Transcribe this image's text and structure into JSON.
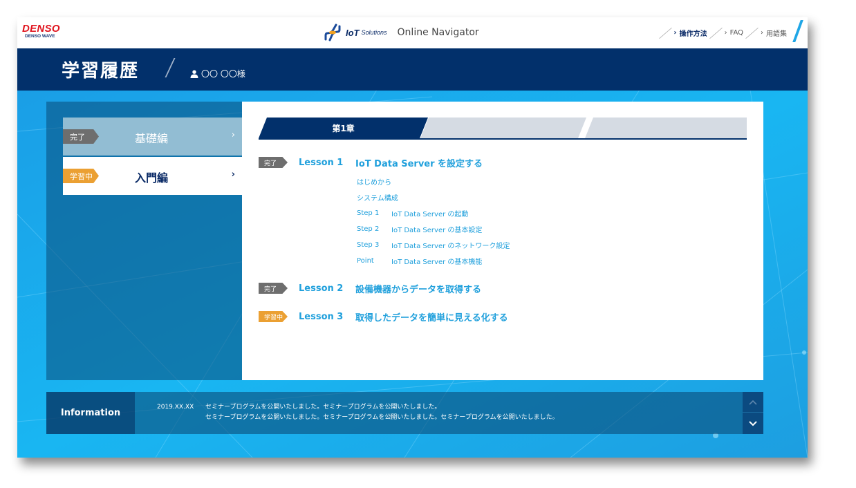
{
  "brand": {
    "name": "DENSO",
    "sub": "DENSO WAVE"
  },
  "header": {
    "product_main": "IoT",
    "product_sub": "Solutions",
    "app_name": "Online Navigator",
    "nav": [
      {
        "label": "操作方法",
        "active": true
      },
      {
        "label": "FAQ",
        "active": false
      },
      {
        "label": "用語集",
        "active": false
      }
    ],
    "chevron": "›"
  },
  "title_band": {
    "title": "学習履歴",
    "user_name": "〇〇 〇〇様",
    "user_icon": "user-icon"
  },
  "sidebar": {
    "items": [
      {
        "badge": "完了",
        "label": "基礎編",
        "chevron": "›",
        "status": "done"
      },
      {
        "badge": "学習中",
        "label": "入門編",
        "chevron": "›",
        "status": "current"
      }
    ]
  },
  "tabs": [
    {
      "label": "第1章",
      "active": true
    },
    {
      "label": "",
      "active": false
    },
    {
      "label": "",
      "active": false
    }
  ],
  "lessons": [
    {
      "badge": "完了",
      "status": "done",
      "number": "Lesson 1",
      "title": "IoT Data Server を設定する",
      "steps": [
        {
          "prefix": "",
          "label": "はじめから"
        },
        {
          "prefix": "",
          "label": "システム構成"
        },
        {
          "prefix": "Step 1",
          "label": "IoT Data Server の起動"
        },
        {
          "prefix": "Step 2",
          "label": "IoT Data Server の基本設定"
        },
        {
          "prefix": "Step 3",
          "label": "IoT Data Server のネットワーク設定"
        },
        {
          "prefix": "Point",
          "label": "IoT Data Server の基本機能"
        }
      ]
    },
    {
      "badge": "完了",
      "status": "done",
      "number": "Lesson 2",
      "title": "設備機器からデータを取得する"
    },
    {
      "badge": "学習中",
      "status": "current",
      "number": "Lesson 3",
      "title": "取得したデータを簡単に見える化する"
    }
  ],
  "information": {
    "label": "Information",
    "date": "2019.XX.XX",
    "line1": "セミナープログラムを公開いたしました。セミナープログラムを公開いたしました。",
    "line2": "セミナープログラムを公開いたしました。セミナープログラムを公開いたしました。セミナープログラムを公開いたしました。",
    "up_icon": "chevron-up-icon",
    "down_icon": "chevron-down-icon"
  },
  "colors": {
    "navy": "#02306b",
    "accent_blue": "#20a0dc",
    "done_gray": "#6e6e6e",
    "current_orange": "#eba033",
    "brand_red": "#e0141e"
  }
}
